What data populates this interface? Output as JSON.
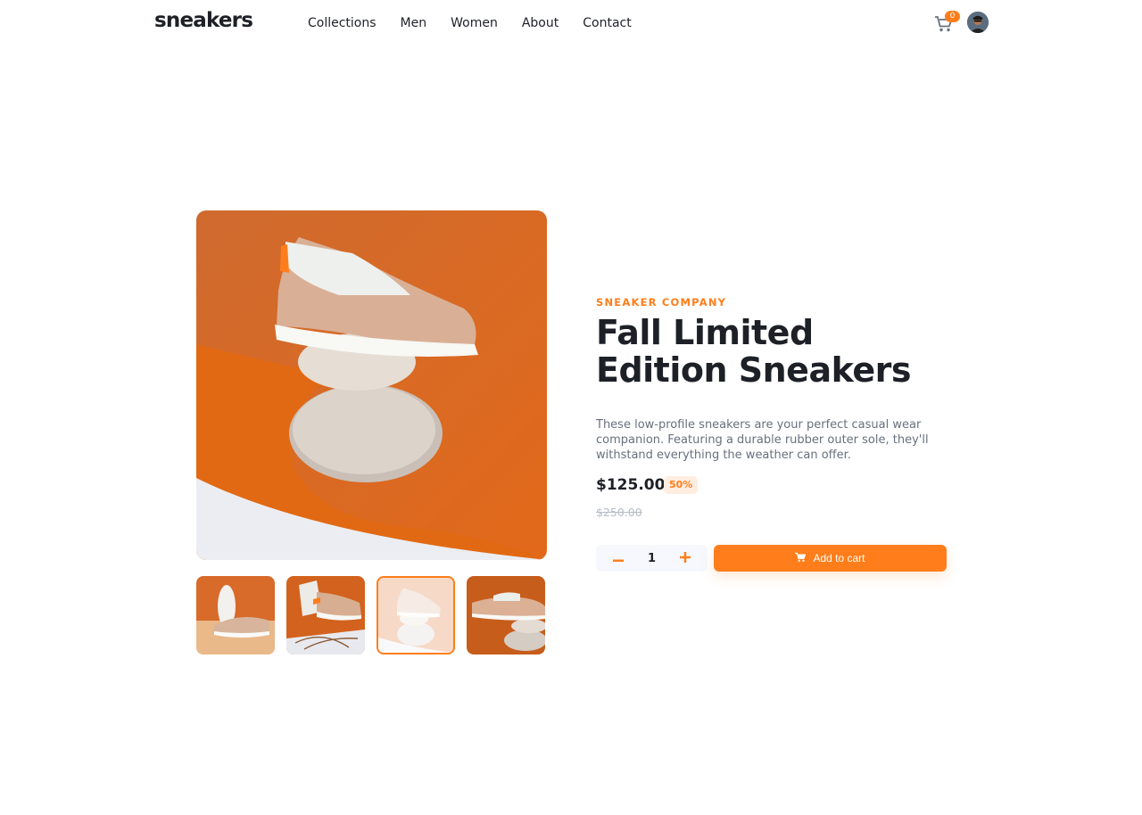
{
  "header": {
    "logo": "sneakers",
    "nav": [
      "Collections",
      "Men",
      "Women",
      "About",
      "Contact"
    ],
    "cart_count": "0"
  },
  "product": {
    "company": "SNEAKER COMPANY",
    "title": "Fall Limited Edition Sneakers",
    "description": "These low-profile sneakers are your perfect casual wear companion. Featuring a durable rubber outer sole, they'll withstand everything the weather can offer.",
    "price": "$125.00",
    "discount": "50%",
    "old_price": "$250.00",
    "quantity": "1",
    "add_to_cart_label": "Add to cart"
  },
  "colors": {
    "accent": "#ff7e1b",
    "accent_pale": "#ffede0",
    "text_dark": "#1d2026",
    "text_grey": "#68707d"
  },
  "gallery": {
    "active_thumbnail": 3
  }
}
